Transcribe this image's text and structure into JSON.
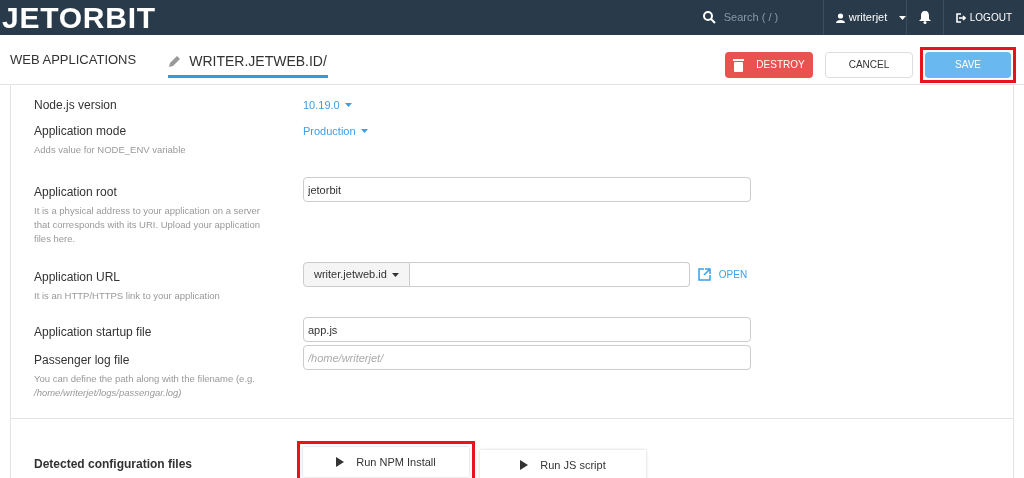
{
  "navbar": {
    "logo": "JETORBIT",
    "search_placeholder": "Search ( / )",
    "user": "writerjet",
    "logout": "LOGOUT"
  },
  "breadcrumb": {
    "section": "WEB APPLICATIONS",
    "app": "WRITER.JETWEB.ID/"
  },
  "actions": [
    {
      "kind": "destroy",
      "label": "DESTROY",
      "highlighted": false
    },
    {
      "kind": "cancel",
      "label": "CANCEL",
      "highlighted": false
    },
    {
      "kind": "save",
      "label": "SAVE",
      "highlighted": true
    }
  ],
  "settings": [
    {
      "kind": "dropdown",
      "label": "Node.js version",
      "value": "10.19.0"
    },
    {
      "kind": "dropdown",
      "label": "Application mode",
      "value": "Production",
      "help": "Adds value for NODE_ENV variable"
    },
    {
      "kind": "text",
      "label": "Application root",
      "value": "jetorbit",
      "help": "It is a physical address to your application on a server that corresponds with its URI. Upload your application files here."
    },
    {
      "kind": "url",
      "label": "Application URL",
      "domain": "writer.jetweb.id",
      "link": "OPEN",
      "help": "It is an HTTP/HTTPS link to your application"
    },
    {
      "kind": "text",
      "label": "Application startup file",
      "value": "app.js"
    },
    {
      "kind": "text",
      "label": "Passenger log file",
      "placeholder": "/home/writerjet/",
      "help": "You can define the path along with the filename (e.g. */home/writerjet/logs/passengar.log)*"
    }
  ],
  "config": {
    "label": "Detected configuration files",
    "buttons": [
      {
        "label": "Run NPM Install",
        "highlighted": true
      },
      {
        "label": "Run JS script",
        "highlighted": false
      }
    ]
  }
}
